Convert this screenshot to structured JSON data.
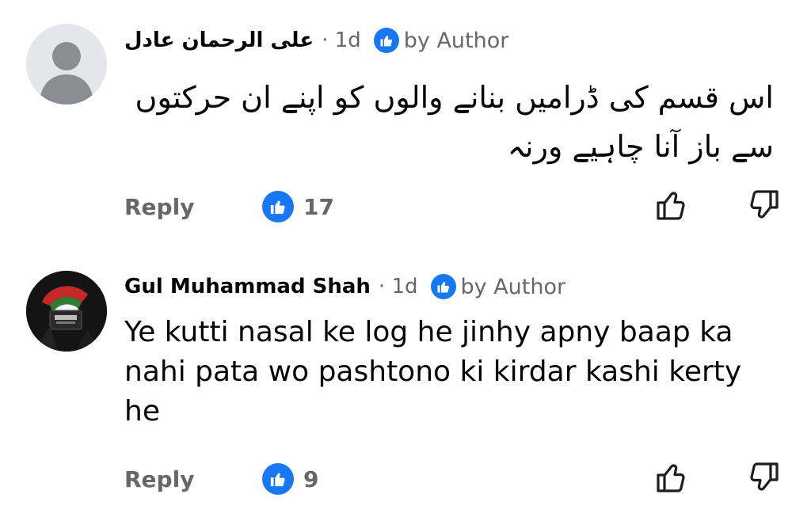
{
  "comments": [
    {
      "author": "علی الرحمان عادل",
      "separator_time": "· 1d",
      "badge_label": "by Author",
      "text": "اس قسم کی ڈرامیں بنانے والوں کو اپنے ان حرکتوں سے باز آنا چاہیے ورنہ",
      "reply_label": "Reply",
      "like_count": "17",
      "avatar": "default-person-avatar"
    },
    {
      "author": "Gul Muhammad Shah",
      "separator_time": "· 1d",
      "badge_label": "by Author",
      "text": "Ye kutti nasal ke log he jinhy apny baap ka nahi pata wo pashtono ki kirdar kashi kerty he",
      "reply_label": "Reply",
      "like_count": "9",
      "avatar": "profile-photo-avatar"
    }
  ],
  "colors": {
    "accent": "#1877f2",
    "secondary_text": "#65676b",
    "primary_text": "#050505",
    "avatar_bg": "#e4e6eb",
    "avatar_fg": "#8a8d91"
  }
}
